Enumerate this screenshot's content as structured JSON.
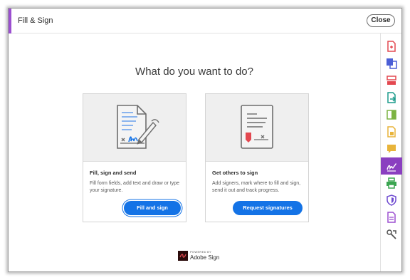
{
  "window": {
    "title": "Fill & Sign",
    "close_label": "Close"
  },
  "main": {
    "question": "What do you want to do?"
  },
  "cards": [
    {
      "title": "Fill, sign and send",
      "description": "Fill form fields, add text and draw or type your signature.",
      "button_label": "Fill and sign"
    },
    {
      "title": "Get others to sign",
      "description": "Add signers, mark where to fill and sign, send it out and track progress.",
      "button_label": "Request signatures"
    }
  ],
  "footer": {
    "powered_by": "POWERED BY",
    "brand": "Adobe Sign"
  },
  "rail_tools": [
    {
      "icon": "create-pdf-icon",
      "color": "#e34850"
    },
    {
      "icon": "combine-files-icon",
      "color": "#4b5fd6"
    },
    {
      "icon": "organize-pages-icon",
      "color": "#e34850"
    },
    {
      "icon": "export-pdf-icon",
      "color": "#1c9b8b"
    },
    {
      "icon": "edit-pdf-icon",
      "color": "#7cb342"
    },
    {
      "icon": "scan-icon",
      "color": "#e8b43a"
    },
    {
      "icon": "comment-icon",
      "color": "#e8b43a"
    },
    {
      "icon": "fill-sign-icon",
      "color": "#ffffff",
      "active": true
    },
    {
      "icon": "print-production-icon",
      "color": "#3aa550"
    },
    {
      "icon": "protect-icon",
      "color": "#6e4ad0"
    },
    {
      "icon": "send-for-signature-icon",
      "color": "#9b4fd0"
    },
    {
      "icon": "more-tools-icon",
      "color": "#505050"
    }
  ],
  "colors": {
    "accent": "#9b4fd0",
    "active_tool": "#8a3fc0",
    "primary_button": "#1473e6"
  }
}
